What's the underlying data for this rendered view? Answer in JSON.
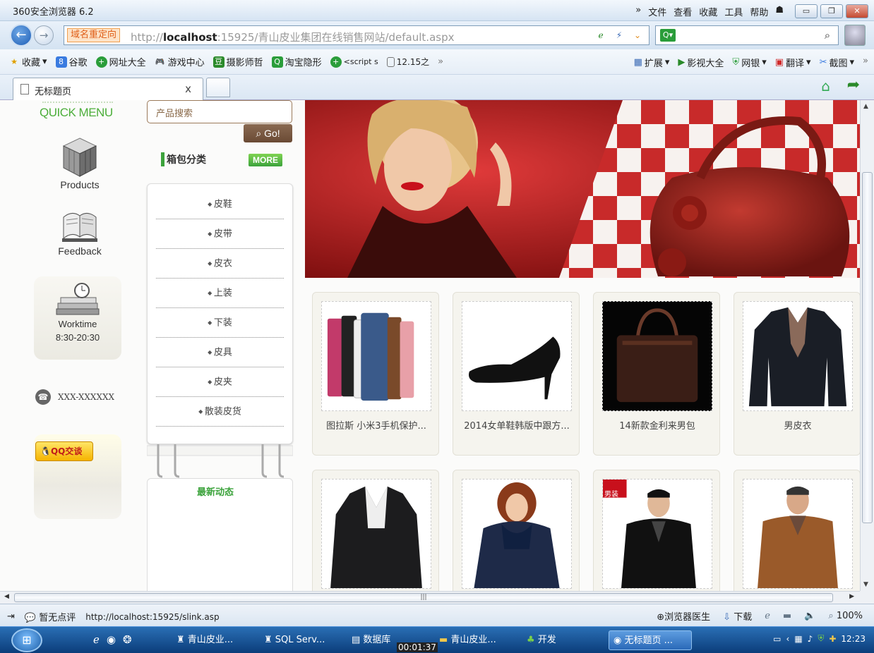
{
  "browser": {
    "app_title": "360安全浏览器 6.2",
    "menu": [
      "»",
      "文件",
      "查看",
      "收藏",
      "工具",
      "帮助"
    ],
    "redirect_label": "域名重定向",
    "url_prefix": "http://",
    "url_host": "localhost",
    "url_rest": ":15925/青山皮业集团在线销售网站/default.aspx"
  },
  "favorites": {
    "items": [
      "收藏",
      "谷歌",
      "网址大全",
      "游戏中心",
      "摄影师哲",
      "淘宝隐形",
      "<script s",
      "12.15之"
    ],
    "more": "»",
    "right_items": [
      "扩展",
      "影视大全",
      "网银",
      "翻译",
      "截图"
    ],
    "right_more": "»"
  },
  "tab": {
    "title": "无标题页",
    "close": "x"
  },
  "page": {
    "quick_menu_title": "QUICK MENU",
    "qm_products": "Products",
    "qm_feedback": "Feedback",
    "worktime_label": "Worktime",
    "worktime_hours": "8:30-20:30",
    "phone": "XXX-XXXXXX",
    "qq_label": "QQ交谈",
    "search_placeholder": "产品搜索",
    "go_label": "Go!",
    "category_heading": "箱包分类",
    "more_label": "MORE",
    "categories": [
      "皮鞋",
      "皮带",
      "皮衣",
      "上装",
      "下装",
      "皮具",
      "皮夹",
      "散装皮货"
    ],
    "news_heading": "最新动态",
    "products": [
      {
        "name": "图拉斯 小米3手机保护..."
      },
      {
        "name": "2014女单鞋韩版中跟方..."
      },
      {
        "name": "14新款金利来男包"
      },
      {
        "name": "男皮衣"
      },
      {
        "name": ""
      },
      {
        "name": ""
      },
      {
        "name": ""
      },
      {
        "name": ""
      }
    ],
    "product_badge": "男装"
  },
  "status": {
    "review": "暂无点评",
    "link_url": "http://localhost:15925/slink.asp",
    "doctor": "浏览器医生",
    "download": "下载",
    "zoom": "100%"
  },
  "taskbar": {
    "items": [
      "青山皮业...",
      "SQL Serv...",
      "数据库",
      "青山皮业...",
      "开发",
      "无标题页 ..."
    ],
    "timer": "00:01:37",
    "clock": "12:23"
  },
  "colors": {
    "green_accent": "#3ca33c",
    "brown_button": "#6a4a34",
    "banner_red": "#b92020"
  }
}
